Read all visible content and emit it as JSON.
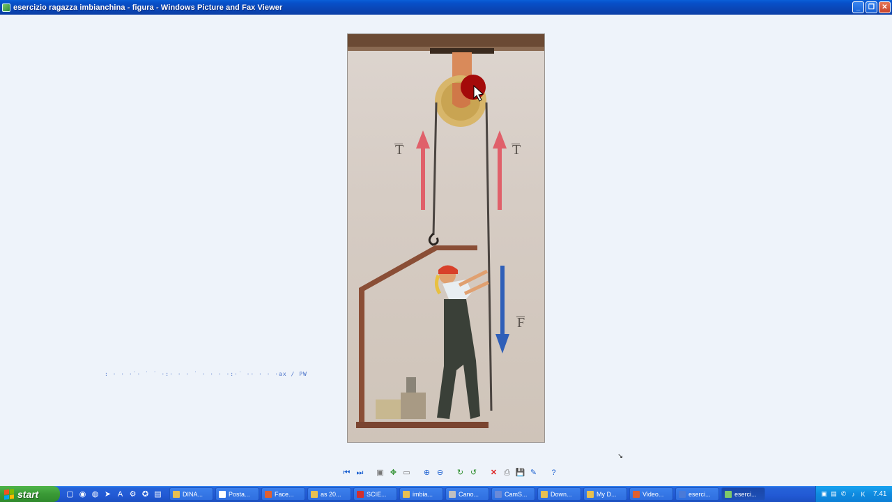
{
  "window": {
    "title": "esercizio ragazza imbianchina - figura - Windows Picture and Fax Viewer",
    "minimize": "_",
    "maximize": "❐",
    "close": "✕"
  },
  "picture": {
    "label_t_left": "T",
    "label_t_right": "T",
    "label_f": "F",
    "colors": {
      "tension_arrow": "#e0606a",
      "force_arrow": "#2f5fb8",
      "rope": "#4a4440",
      "beam": "#5b3a26"
    }
  },
  "noise_text": ":  ·  ·  ·˙·  ˙ ˙ ·:·  · · ˙ ·  ·  ·  ·:·˙  ·· ·  ·  ·ax / PW",
  "toolbar": {
    "prev": "⏮",
    "next": "⏭",
    "best_fit": "▣",
    "actual_size": "✥",
    "slideshow": "▭",
    "zoom_in": "⊕",
    "zoom_out": "⊖",
    "rotate_cw": "↻",
    "rotate_ccw": "↺",
    "delete": "✕",
    "print": "⎙",
    "save": "💾",
    "edit": "✎",
    "help": "?"
  },
  "taskbar": {
    "start_label": "start",
    "quick_launch": [
      "▢",
      "◉",
      "◍",
      "➤",
      "A",
      "⚙",
      "✪",
      "▤"
    ],
    "tasks": [
      {
        "label": "DINA...",
        "icon_color": "#e8c050"
      },
      {
        "label": "Posta...",
        "icon_color": "#ffffff"
      },
      {
        "label": "Face...",
        "icon_color": "#e06030"
      },
      {
        "label": "as 20...",
        "icon_color": "#e8c050"
      },
      {
        "label": "SCIE...",
        "icon_color": "#d03030"
      },
      {
        "label": "imbia...",
        "icon_color": "#e8c050"
      },
      {
        "label": "Cano...",
        "icon_color": "#c0c0c0"
      },
      {
        "label": "CamS...",
        "icon_color": "#6a8ad8"
      },
      {
        "label": "Down...",
        "icon_color": "#e8c050"
      },
      {
        "label": "My D...",
        "icon_color": "#e8c050"
      },
      {
        "label": "Video...",
        "icon_color": "#e06030"
      },
      {
        "label": "eserci...",
        "icon_color": "#4a7ad8"
      },
      {
        "label": "eserci...",
        "icon_color": "#7ec86a"
      }
    ],
    "tray_icons": [
      "▣",
      "▤",
      "✆",
      "♪",
      "K"
    ],
    "clock": "7.41"
  }
}
